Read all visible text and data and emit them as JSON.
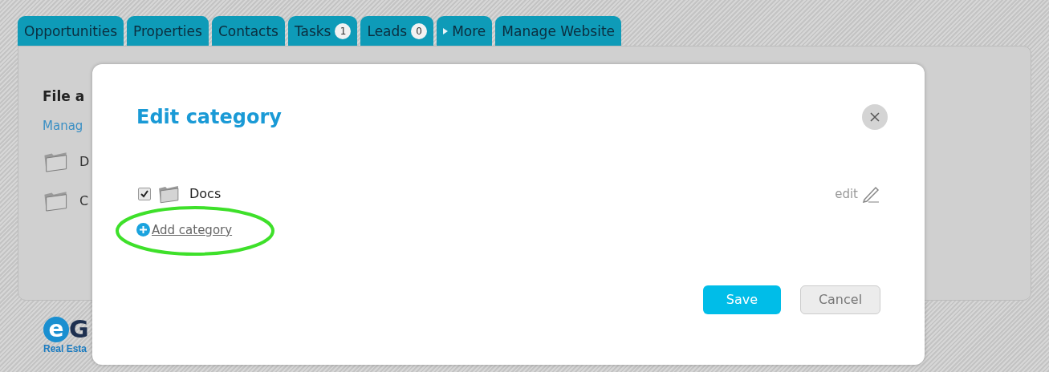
{
  "tabs": [
    {
      "label": "Opportunities",
      "kind": "plain"
    },
    {
      "label": "Properties",
      "kind": "plain"
    },
    {
      "label": "Contacts",
      "kind": "plain"
    },
    {
      "label": "Tasks",
      "kind": "badge",
      "badge": "1"
    },
    {
      "label": "Leads",
      "kind": "badge",
      "badge": "0"
    },
    {
      "label": "More",
      "kind": "menu"
    },
    {
      "label": "Manage Website",
      "kind": "plain"
    }
  ],
  "background": {
    "heading": "File a",
    "link": "Manag",
    "folders": [
      "D",
      "C"
    ],
    "logo": {
      "mark": "e",
      "text": "G",
      "tagline": "Real Esta"
    }
  },
  "dialog": {
    "title": "Edit category",
    "categories": [
      {
        "name": "Docs",
        "checked": true,
        "action": "edit"
      }
    ],
    "add_link": "Add category",
    "buttons": [
      {
        "label": "Save",
        "kind": "primary"
      },
      {
        "label": "Cancel",
        "kind": "secondary"
      }
    ]
  }
}
